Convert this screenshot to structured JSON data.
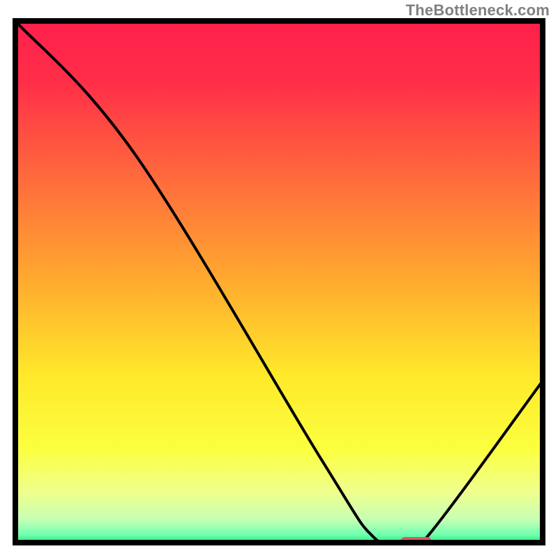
{
  "watermark": "TheBottleneck.com",
  "chart_data": {
    "type": "line",
    "title": "",
    "xlabel": "",
    "ylabel": "",
    "xlim": [
      0,
      100
    ],
    "ylim": [
      0,
      100
    ],
    "grid": false,
    "series": [
      {
        "name": "bottleneck-curve",
        "x": [
          0,
          23,
          58,
          68,
          74,
          78,
          100
        ],
        "y": [
          100,
          74,
          16,
          1,
          0,
          1,
          31
        ]
      }
    ],
    "marker": {
      "name": "optimal-range",
      "x_center": 76,
      "y": 0,
      "width": 6,
      "color": "#cf5b69"
    },
    "gradient_stops": [
      {
        "offset": 0.0,
        "color": "#ff1f4b"
      },
      {
        "offset": 0.12,
        "color": "#ff2f48"
      },
      {
        "offset": 0.3,
        "color": "#ff6a3c"
      },
      {
        "offset": 0.5,
        "color": "#ffab2f"
      },
      {
        "offset": 0.68,
        "color": "#ffe92a"
      },
      {
        "offset": 0.82,
        "color": "#fbff3f"
      },
      {
        "offset": 0.9,
        "color": "#f0ff8a"
      },
      {
        "offset": 0.955,
        "color": "#c8ffb4"
      },
      {
        "offset": 0.985,
        "color": "#6fffb0"
      },
      {
        "offset": 1.0,
        "color": "#28e57a"
      }
    ],
    "frame": {
      "stroke": "#000000",
      "stroke_width": 8
    },
    "curve_style": {
      "stroke": "#000000",
      "stroke_width": 4
    }
  }
}
